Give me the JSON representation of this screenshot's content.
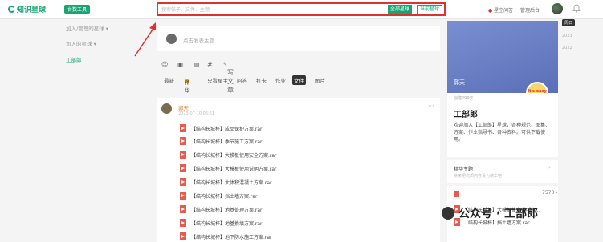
{
  "header": {
    "logo": "知识星球",
    "badge": "台数工具",
    "search_placeholder": "搜索帖子、文件、主题",
    "btn_all": "全部星球",
    "btn_this": "当前星球",
    "ask": "星空问答",
    "admin": "管理后台"
  },
  "side_left": {
    "items": [
      "加入/管理的星球 ▾",
      "加入的星球 ▾"
    ],
    "active": "工部郎"
  },
  "compose": {
    "placeholder": "点击发表主题..."
  },
  "toolbar": {
    "qa": "写文章"
  },
  "filters": [
    "最新",
    "精华",
    "只看星主",
    "问答",
    "打卡",
    "作业",
    "文件",
    "图片"
  ],
  "post": {
    "name": "郭天",
    "time": "2023-07-10 06:51",
    "files": [
      "【结构长城杯】成品保护方案.rar",
      "【结构长城杯】季节施工方案.rar",
      "【结构长城杯】大模板使用安全方案.rar",
      "【结构长城杯】大模板使用说明方案.rar",
      "【结构长城杯】大体积混凝土方案.rar",
      "【结构长城杯】挡土墙方案.rar",
      "【结构长城杯】地基处理方案.rar",
      "【结构长城杯】地基换填方案.rar",
      "【结构长城杯】地下防水施工方案.rar"
    ]
  },
  "group": {
    "owner": "郭天",
    "badge": "It's easy if you try",
    "created": "创建299天",
    "name": "工部郎",
    "desc": "欢迎加入【工部郎】星球，各种规范、图集、方案、作业指导书、各种资料。可供下载使用。",
    "topic_title": "精华主题",
    "topic_sub": "快来把优质内容设为精华吧",
    "file_count": "7570",
    "files": [
      "【结构长城杯】大模板使用说明方...",
      "【结构长城杯】挡土墙方案.rar"
    ]
  },
  "years": [
    "周日",
    "2023",
    "2022"
  ],
  "watermark": {
    "text": "公众号 · 工部郎"
  }
}
